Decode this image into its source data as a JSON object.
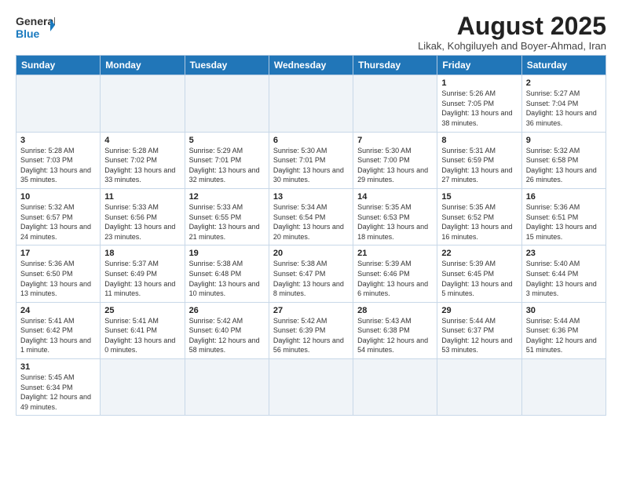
{
  "header": {
    "logo_general": "General",
    "logo_blue": "Blue",
    "title": "August 2025",
    "subtitle": "Likak, Kohgiluyeh and Boyer-Ahmad, Iran"
  },
  "weekdays": [
    "Sunday",
    "Monday",
    "Tuesday",
    "Wednesday",
    "Thursday",
    "Friday",
    "Saturday"
  ],
  "weeks": [
    [
      {
        "day": "",
        "info": ""
      },
      {
        "day": "",
        "info": ""
      },
      {
        "day": "",
        "info": ""
      },
      {
        "day": "",
        "info": ""
      },
      {
        "day": "",
        "info": ""
      },
      {
        "day": "1",
        "info": "Sunrise: 5:26 AM\nSunset: 7:05 PM\nDaylight: 13 hours and 38 minutes."
      },
      {
        "day": "2",
        "info": "Sunrise: 5:27 AM\nSunset: 7:04 PM\nDaylight: 13 hours and 36 minutes."
      }
    ],
    [
      {
        "day": "3",
        "info": "Sunrise: 5:28 AM\nSunset: 7:03 PM\nDaylight: 13 hours and 35 minutes."
      },
      {
        "day": "4",
        "info": "Sunrise: 5:28 AM\nSunset: 7:02 PM\nDaylight: 13 hours and 33 minutes."
      },
      {
        "day": "5",
        "info": "Sunrise: 5:29 AM\nSunset: 7:01 PM\nDaylight: 13 hours and 32 minutes."
      },
      {
        "day": "6",
        "info": "Sunrise: 5:30 AM\nSunset: 7:01 PM\nDaylight: 13 hours and 30 minutes."
      },
      {
        "day": "7",
        "info": "Sunrise: 5:30 AM\nSunset: 7:00 PM\nDaylight: 13 hours and 29 minutes."
      },
      {
        "day": "8",
        "info": "Sunrise: 5:31 AM\nSunset: 6:59 PM\nDaylight: 13 hours and 27 minutes."
      },
      {
        "day": "9",
        "info": "Sunrise: 5:32 AM\nSunset: 6:58 PM\nDaylight: 13 hours and 26 minutes."
      }
    ],
    [
      {
        "day": "10",
        "info": "Sunrise: 5:32 AM\nSunset: 6:57 PM\nDaylight: 13 hours and 24 minutes."
      },
      {
        "day": "11",
        "info": "Sunrise: 5:33 AM\nSunset: 6:56 PM\nDaylight: 13 hours and 23 minutes."
      },
      {
        "day": "12",
        "info": "Sunrise: 5:33 AM\nSunset: 6:55 PM\nDaylight: 13 hours and 21 minutes."
      },
      {
        "day": "13",
        "info": "Sunrise: 5:34 AM\nSunset: 6:54 PM\nDaylight: 13 hours and 20 minutes."
      },
      {
        "day": "14",
        "info": "Sunrise: 5:35 AM\nSunset: 6:53 PM\nDaylight: 13 hours and 18 minutes."
      },
      {
        "day": "15",
        "info": "Sunrise: 5:35 AM\nSunset: 6:52 PM\nDaylight: 13 hours and 16 minutes."
      },
      {
        "day": "16",
        "info": "Sunrise: 5:36 AM\nSunset: 6:51 PM\nDaylight: 13 hours and 15 minutes."
      }
    ],
    [
      {
        "day": "17",
        "info": "Sunrise: 5:36 AM\nSunset: 6:50 PM\nDaylight: 13 hours and 13 minutes."
      },
      {
        "day": "18",
        "info": "Sunrise: 5:37 AM\nSunset: 6:49 PM\nDaylight: 13 hours and 11 minutes."
      },
      {
        "day": "19",
        "info": "Sunrise: 5:38 AM\nSunset: 6:48 PM\nDaylight: 13 hours and 10 minutes."
      },
      {
        "day": "20",
        "info": "Sunrise: 5:38 AM\nSunset: 6:47 PM\nDaylight: 13 hours and 8 minutes."
      },
      {
        "day": "21",
        "info": "Sunrise: 5:39 AM\nSunset: 6:46 PM\nDaylight: 13 hours and 6 minutes."
      },
      {
        "day": "22",
        "info": "Sunrise: 5:39 AM\nSunset: 6:45 PM\nDaylight: 13 hours and 5 minutes."
      },
      {
        "day": "23",
        "info": "Sunrise: 5:40 AM\nSunset: 6:44 PM\nDaylight: 13 hours and 3 minutes."
      }
    ],
    [
      {
        "day": "24",
        "info": "Sunrise: 5:41 AM\nSunset: 6:42 PM\nDaylight: 13 hours and 1 minute."
      },
      {
        "day": "25",
        "info": "Sunrise: 5:41 AM\nSunset: 6:41 PM\nDaylight: 13 hours and 0 minutes."
      },
      {
        "day": "26",
        "info": "Sunrise: 5:42 AM\nSunset: 6:40 PM\nDaylight: 12 hours and 58 minutes."
      },
      {
        "day": "27",
        "info": "Sunrise: 5:42 AM\nSunset: 6:39 PM\nDaylight: 12 hours and 56 minutes."
      },
      {
        "day": "28",
        "info": "Sunrise: 5:43 AM\nSunset: 6:38 PM\nDaylight: 12 hours and 54 minutes."
      },
      {
        "day": "29",
        "info": "Sunrise: 5:44 AM\nSunset: 6:37 PM\nDaylight: 12 hours and 53 minutes."
      },
      {
        "day": "30",
        "info": "Sunrise: 5:44 AM\nSunset: 6:36 PM\nDaylight: 12 hours and 51 minutes."
      }
    ],
    [
      {
        "day": "31",
        "info": "Sunrise: 5:45 AM\nSunset: 6:34 PM\nDaylight: 12 hours and 49 minutes."
      },
      {
        "day": "",
        "info": ""
      },
      {
        "day": "",
        "info": ""
      },
      {
        "day": "",
        "info": ""
      },
      {
        "day": "",
        "info": ""
      },
      {
        "day": "",
        "info": ""
      },
      {
        "day": "",
        "info": ""
      }
    ]
  ]
}
